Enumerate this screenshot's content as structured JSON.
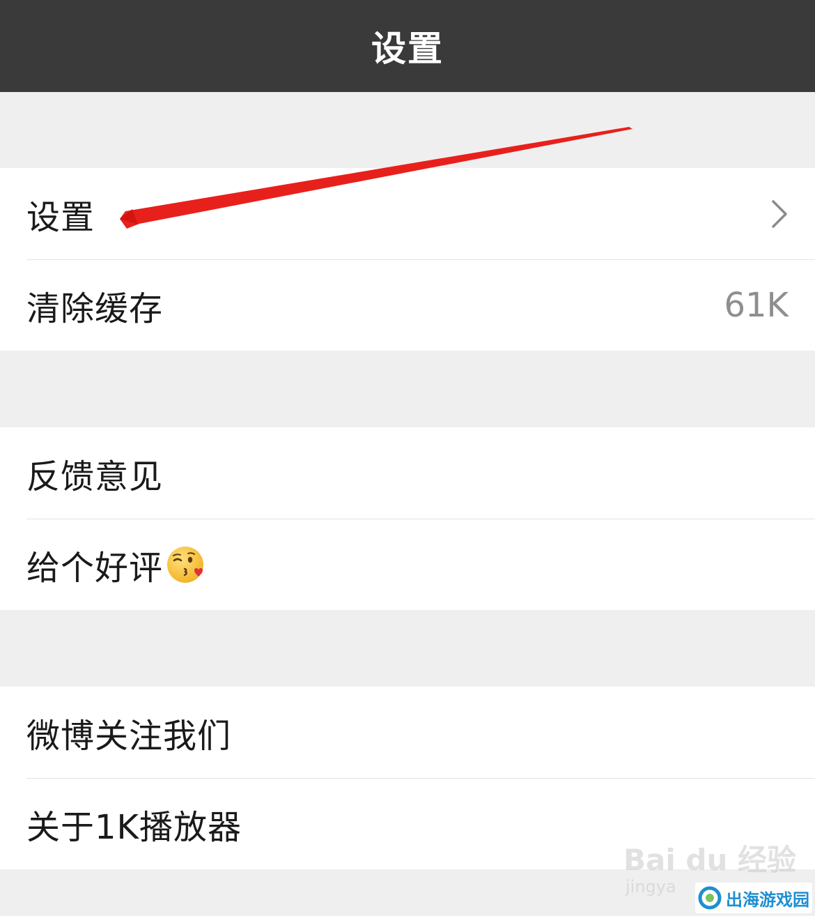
{
  "navbar": {
    "title": "设置"
  },
  "groups": [
    {
      "rows": [
        {
          "label": "设置",
          "has_chevron": true
        },
        {
          "label": "清除缓存",
          "value": "61K"
        }
      ]
    },
    {
      "rows": [
        {
          "label": "反馈意见"
        },
        {
          "label": "给个好评",
          "emoji": "kissing-face-heart-emoji"
        }
      ]
    },
    {
      "rows": [
        {
          "label": "微博关注我们"
        },
        {
          "label": "关于1K播放器"
        }
      ]
    }
  ],
  "annotation": {
    "arrow_color": "#e8201c"
  },
  "watermark": {
    "text": "Bai du 经验",
    "subtext": "jingya"
  },
  "logo": {
    "text": "出海游戏园",
    "color": "#1e8fd0"
  },
  "colors": {
    "navbar_bg": "#3a3a3a",
    "page_bg": "#efefef",
    "row_bg": "#ffffff",
    "value_text": "#8e8e8e"
  }
}
